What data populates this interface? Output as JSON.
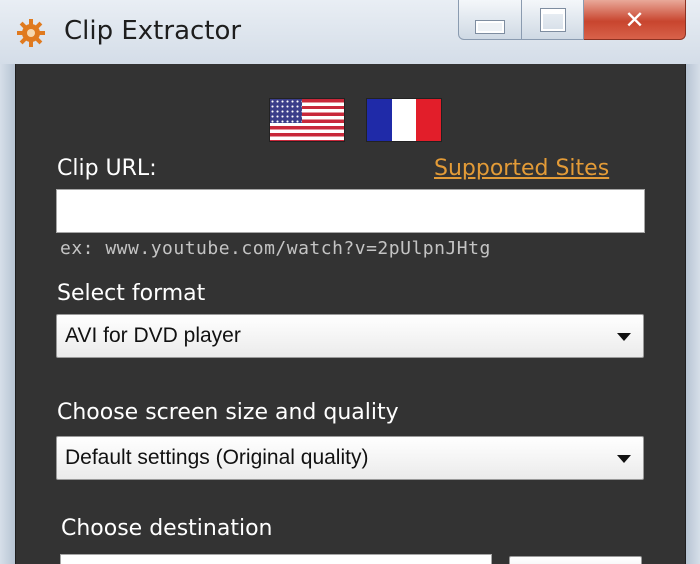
{
  "window": {
    "title": "Clip Extractor",
    "close_symbol": "✕"
  },
  "icons": {
    "app": "gear-icon",
    "minimize": "minimize-icon",
    "maximize": "maximize-icon",
    "close": "close-icon",
    "dropdown": "chevron-down-icon"
  },
  "languages": [
    {
      "name": "english-flag",
      "label": "US flag"
    },
    {
      "name": "french-flag",
      "label": "French flag"
    }
  ],
  "form": {
    "clip_url_label": "Clip URL:",
    "supported_sites_link": "Supported Sites",
    "url_value": "",
    "url_example": "ex: www.youtube.com/watch?v=2pUlpnJHtg",
    "format_label": "Select format",
    "format_value": "AVI for DVD player",
    "quality_label": "Choose screen size and quality",
    "quality_value": "Default settings (Original quality)",
    "destination_label": "Choose destination",
    "destination_value": ""
  },
  "colors": {
    "background": "#333333",
    "link": "#e39b37",
    "text": "#ffffff",
    "hint": "#c4c4c4",
    "close_button": "#c8452e"
  }
}
